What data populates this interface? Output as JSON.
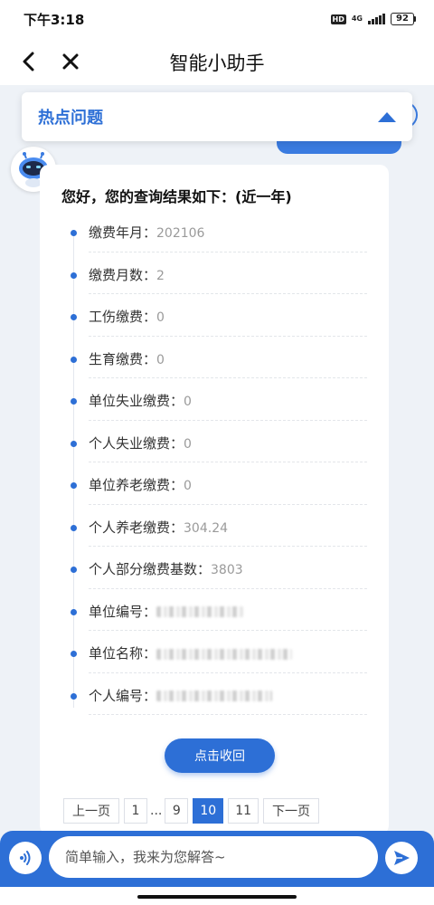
{
  "status_bar": {
    "time": "下午3:18",
    "hd": "HD",
    "network": "4G",
    "battery": "92"
  },
  "nav": {
    "title": "智能小助手"
  },
  "hot_topics": {
    "title": "热点问题"
  },
  "result": {
    "heading": "您好，您的查询结果如下：(近一年)",
    "items": [
      {
        "label": "缴费年月：",
        "value": "202106"
      },
      {
        "label": "缴费月数：",
        "value": "2"
      },
      {
        "label": "工伤缴费：",
        "value": "0"
      },
      {
        "label": "生育缴费：",
        "value": "0"
      },
      {
        "label": "单位失业缴费：",
        "value": "0"
      },
      {
        "label": "个人失业缴费：",
        "value": "0"
      },
      {
        "label": "单位养老缴费：",
        "value": "0"
      },
      {
        "label": "个人养老缴费：",
        "value": "304.24"
      },
      {
        "label": "个人部分缴费基数：",
        "value": "3803"
      },
      {
        "label": "单位编号：",
        "value": ""
      },
      {
        "label": "单位名称：",
        "value": ""
      },
      {
        "label": "个人编号：",
        "value": ""
      }
    ],
    "collapse_label": "点击收回"
  },
  "pagination": {
    "prev": "上一页",
    "pages": [
      "1",
      "...",
      "9",
      "10",
      "11"
    ],
    "current": "10",
    "next": "下一页"
  },
  "input_bar": {
    "placeholder": "简单输入，我来为您解答~"
  },
  "colors": {
    "accent": "#2d6fd6",
    "background": "#eef2f7"
  }
}
